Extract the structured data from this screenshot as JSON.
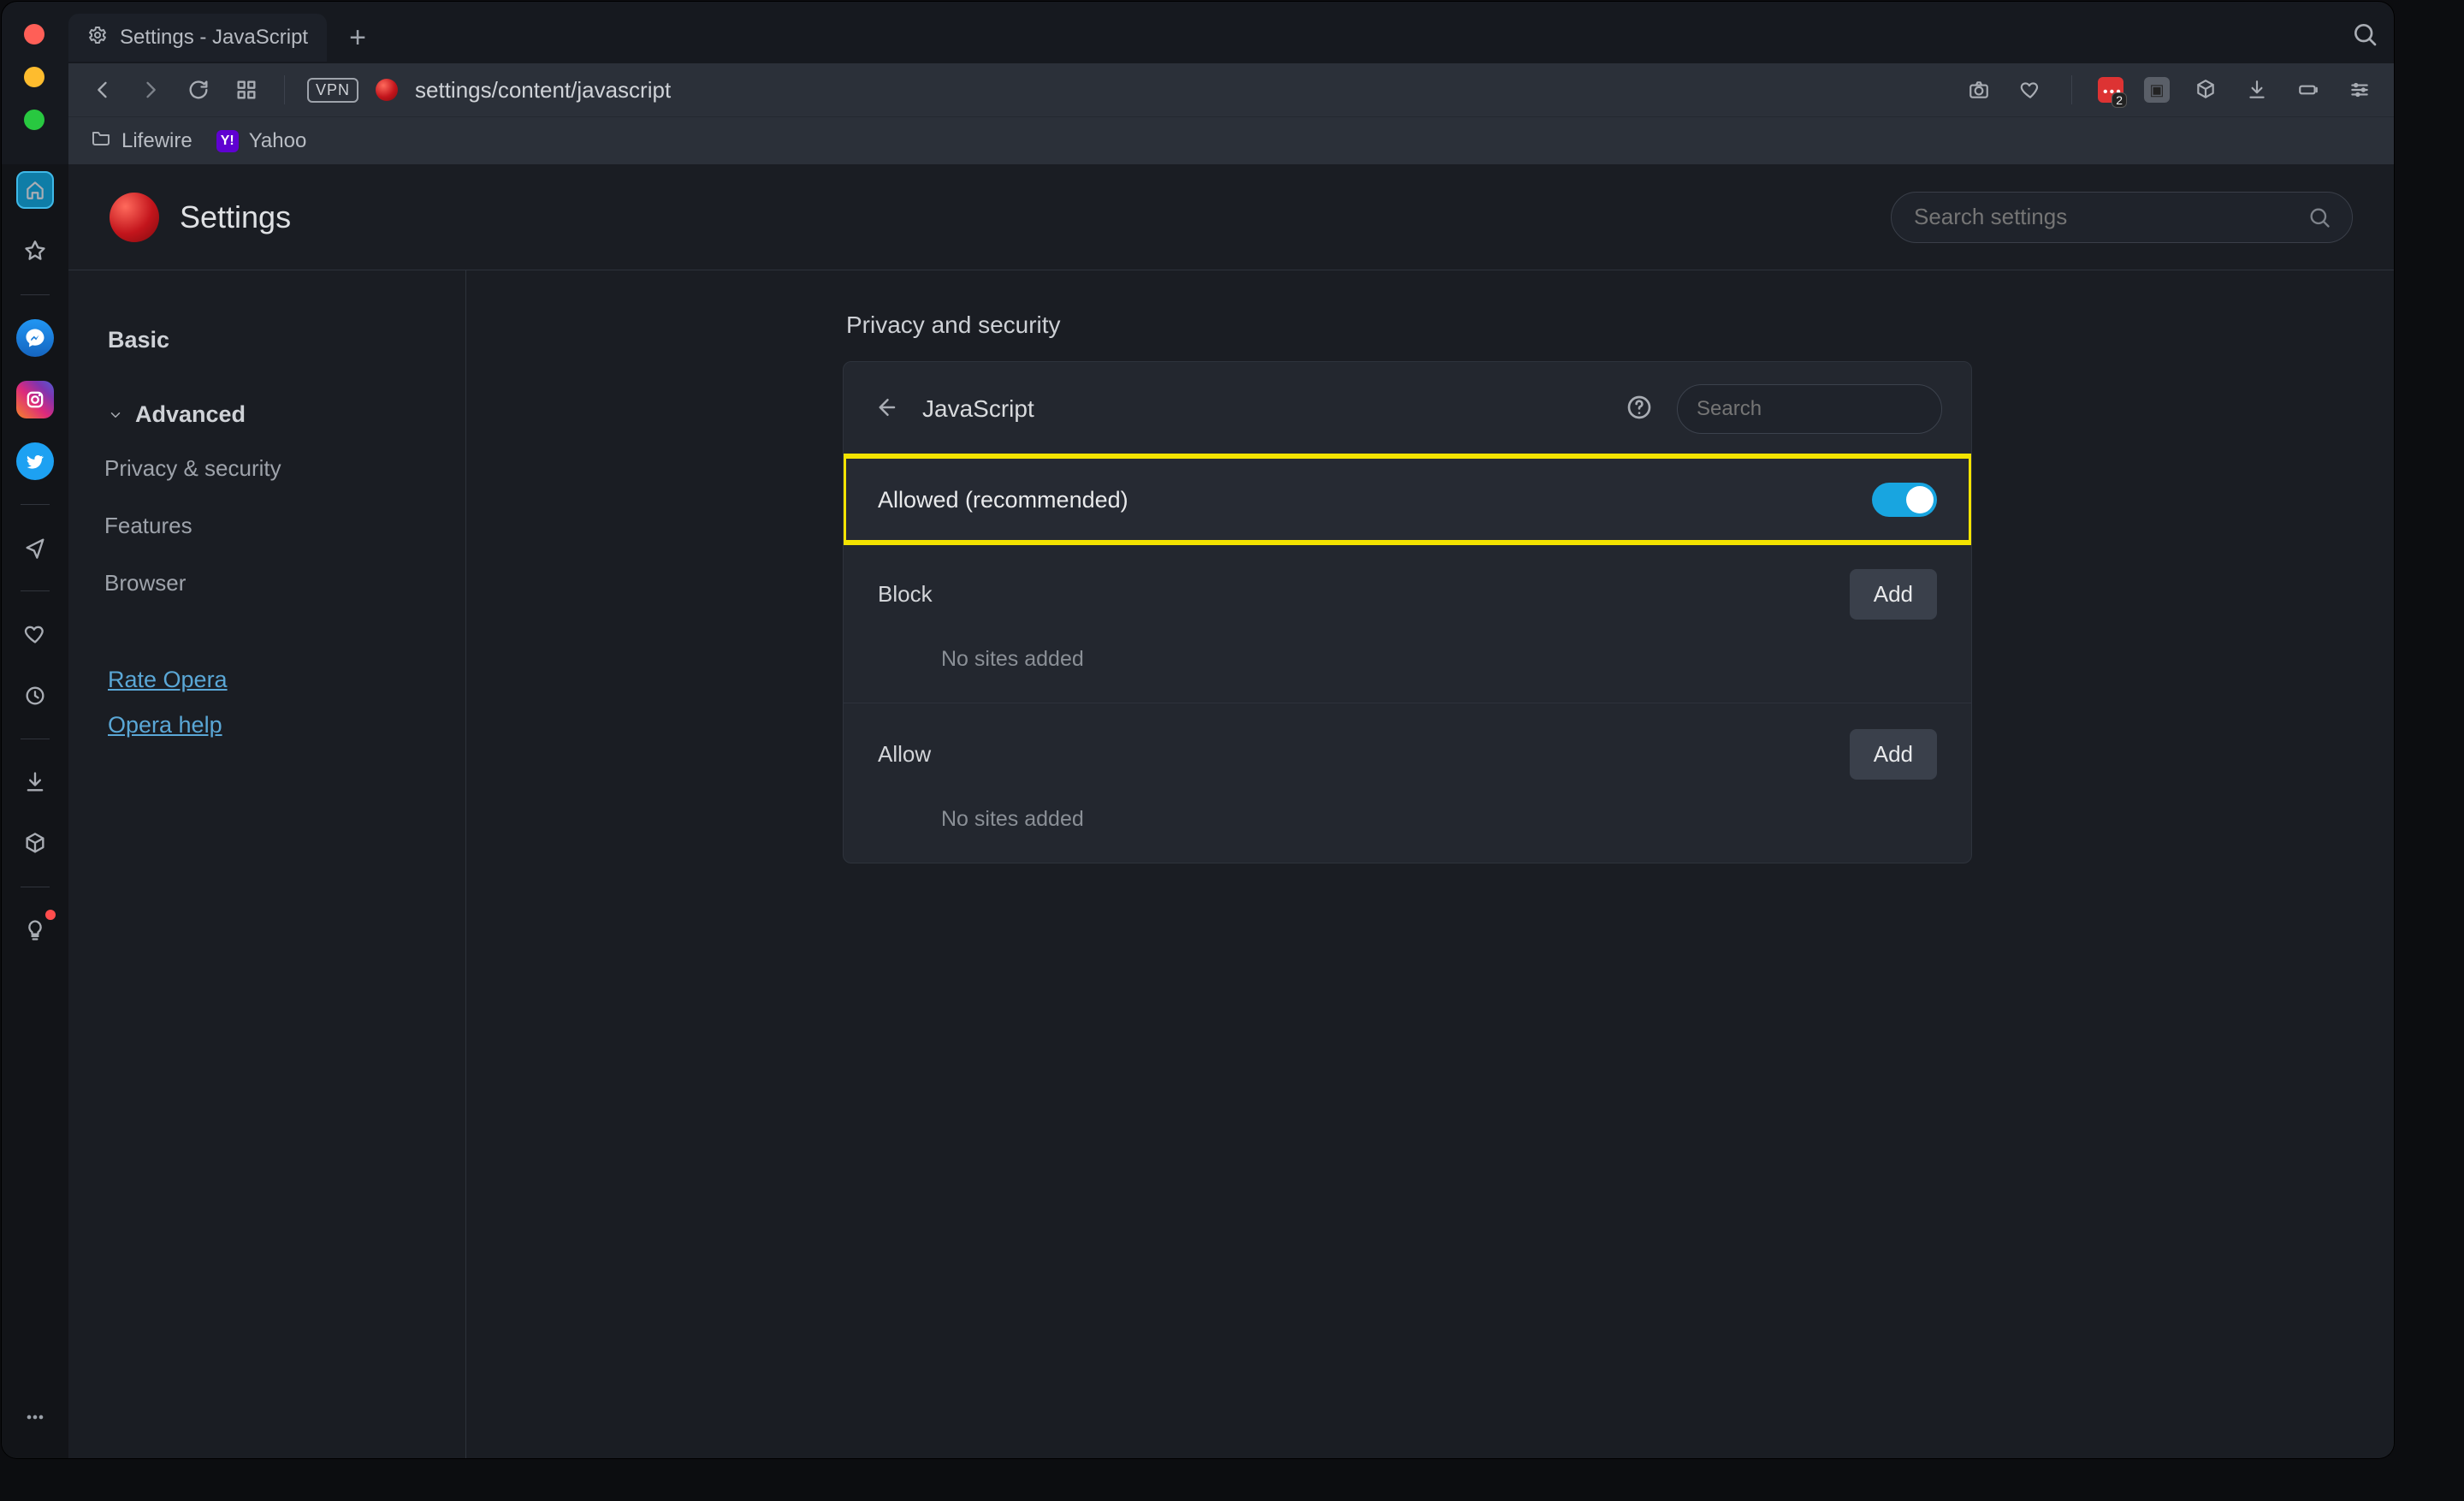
{
  "tab": {
    "title": "Settings - JavaScript"
  },
  "toolbar": {
    "vpn_label": "VPN",
    "url": "settings/content/javascript",
    "ext_badge": "2"
  },
  "bookmarks": {
    "items": [
      {
        "label": "Lifewire",
        "type": "folder"
      },
      {
        "label": "Yahoo",
        "type": "yahoo"
      }
    ]
  },
  "settings_header": {
    "title": "Settings",
    "search_placeholder": "Search settings"
  },
  "sidebar": {
    "basic": "Basic",
    "advanced": "Advanced",
    "items": [
      "Privacy & security",
      "Features",
      "Browser"
    ],
    "links": [
      "Rate Opera",
      "Opera help"
    ]
  },
  "main": {
    "section_title": "Privacy and security",
    "panel_title": "JavaScript",
    "panel_search_placeholder": "Search",
    "allowed_label": "Allowed (recommended)",
    "block_label": "Block",
    "allow_label": "Allow",
    "add_label": "Add",
    "no_sites": "No sites added"
  }
}
